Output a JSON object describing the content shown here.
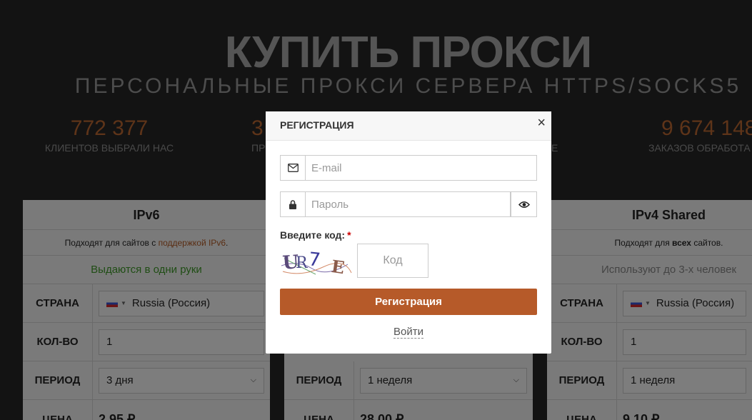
{
  "hero": {
    "title": "КУПИТЬ ПРОКСИ",
    "subtitle": "ПЕРСОНАЛЬНЫЕ ПРОКСИ СЕРВЕРА HTTPS/SOCKS5"
  },
  "stats": [
    {
      "value": "772 377",
      "label": "КЛИЕНТОВ ВЫБРАЛИ НАС"
    },
    {
      "value": "3",
      "label": "ПР"
    },
    {
      "value": "",
      "label": "Е"
    },
    {
      "value": "9 674 148",
      "label": "ЗАКАЗОВ ОБРАБОТА"
    }
  ],
  "cards": [
    {
      "title": "IPv6",
      "desc_prefix": "Подходят для сайтов с ",
      "desc_link": "поддержкой IPv6",
      "desc_suffix": ".",
      "note": "Выдаются в одни руки",
      "note_color": "#1f4d14",
      "country_label": "СТРАНА",
      "country_value": "Russia (Россия)",
      "qty_label": "КОЛ-ВО",
      "qty_value": "1",
      "period_label": "ПЕРИОД",
      "period_value": "3 дня",
      "price_label": "ЦЕНА",
      "price_value": "2.95 ₽"
    },
    {
      "title": "",
      "period_label": "ПЕРИОД",
      "period_value": "1 неделя",
      "price_label": "ЦЕНА",
      "price_value": "28.00 ₽"
    },
    {
      "title": "IPv4 Shared",
      "desc_prefix": "Подходят для ",
      "desc_bold": "всех",
      "desc_suffix": " сайтов.",
      "note": "Используют до 3-х человек",
      "note_color": "#444444",
      "country_label": "СТРАНА",
      "country_value": "Russia (Россия)",
      "qty_label": "КОЛ-ВО",
      "qty_value": "1",
      "period_label": "ПЕРИОД",
      "period_value": "1 неделя",
      "price_label": "ЦЕНА",
      "price_value": "9.10 ₽"
    }
  ],
  "modal": {
    "title": "РЕГИСТРАЦИЯ",
    "close_symbol": "×",
    "email_placeholder": "E-mail",
    "email_icon": "envelope-icon",
    "password_placeholder": "Пароль",
    "password_icon": "lock-icon",
    "show_password_icon": "eye-icon",
    "captcha_label": "Введите код:",
    "captcha_required": "*",
    "captcha_text": "UR7 E",
    "code_placeholder": "Код",
    "submit_label": "Регистрация",
    "login_label": "Войти"
  },
  "colors": {
    "accent": "#b65a29",
    "background": "#131313"
  }
}
